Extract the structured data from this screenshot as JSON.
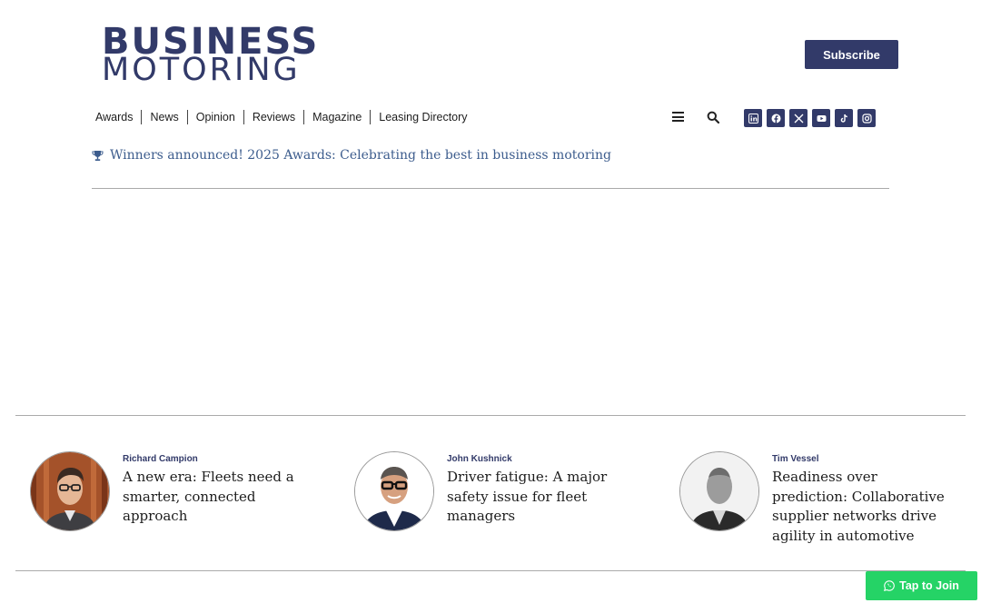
{
  "brand": {
    "line1": "BUSINESS",
    "line2": "MOTORING",
    "color": "#323a69"
  },
  "header": {
    "subscribe_label": "Subscribe"
  },
  "nav": {
    "items": [
      "Awards",
      "News",
      "Opinion",
      "Reviews",
      "Magazine",
      "Leasing Directory"
    ]
  },
  "toolbar_icons": [
    "menu-icon",
    "search-icon"
  ],
  "socials": [
    "linkedin-icon",
    "facebook-icon",
    "x-icon",
    "youtube-icon",
    "tiktok-icon",
    "instagram-icon"
  ],
  "announcement": {
    "icon": "trophy-icon",
    "text": "Winners announced! 2025 Awards: Celebrating the best in business motoring",
    "color": "#3c5c8d"
  },
  "opinion_cards": [
    {
      "author": "Richard Campion",
      "headline": "A new era: Fleets need a smarter, connected approach"
    },
    {
      "author": "John Kushnick",
      "headline": "Driver fatigue: A major safety issue for fleet managers"
    },
    {
      "author": "Tim Vessel",
      "headline": "Readiness over prediction: Collaborative supplier networks drive agility in automotive"
    }
  ],
  "whatsapp": {
    "label": "Tap to Join",
    "icon": "whatsapp-icon",
    "color": "#25d366"
  }
}
